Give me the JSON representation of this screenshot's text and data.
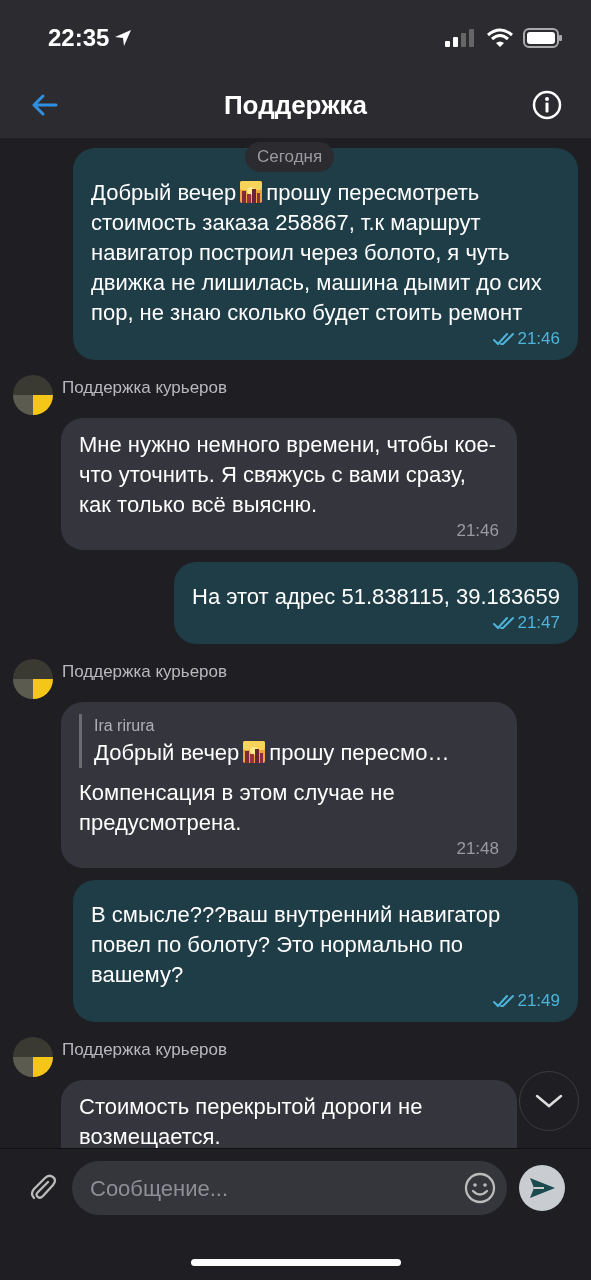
{
  "status_bar": {
    "time": "22:35"
  },
  "header": {
    "title": "Поддержка"
  },
  "date_label": "Сегодня",
  "messages": [
    {
      "kind": "outgoing",
      "segments": [
        {
          "kind": "text",
          "text": "Добрый вечер"
        },
        {
          "kind": "emoji"
        },
        {
          "kind": "text",
          "text": "прошу пересмотреть стоимость заказа 258867, т.к маршрут навигатор построил через болото, я чуть движка не лишилась, машина дымит до сих пор, не знаю сколько будет стоить ремонт"
        }
      ],
      "time": "21:46",
      "read": true
    },
    {
      "kind": "incoming",
      "sender": "Поддержка курьеров",
      "segments": [
        {
          "kind": "text",
          "text": "Мне нужно немного времени, чтобы кое-что уточнить. Я свяжусь с вами сразу, как только всё выясню."
        }
      ],
      "time": "21:46"
    },
    {
      "kind": "outgoing",
      "segments": [
        {
          "kind": "text",
          "text": "На этот адрес 51.838115, 39.183659"
        }
      ],
      "time": "21:47",
      "read": true
    },
    {
      "kind": "incoming",
      "sender": "Поддержка курьеров",
      "reply_to": {
        "author": "Ira rirura",
        "segments": [
          {
            "kind": "text",
            "text": "Добрый вечер"
          },
          {
            "kind": "emoji"
          },
          {
            "kind": "text",
            "text": "прошу пересмо…"
          }
        ]
      },
      "segments": [
        {
          "kind": "text",
          "text": "Компенсация в этом случае не предусмотрена."
        }
      ],
      "time": "21:48"
    },
    {
      "kind": "outgoing",
      "segments": [
        {
          "kind": "text",
          "text": "В смысле???ваш внутренний навигатор повел по болоту? Это нормально по вашему?"
        }
      ],
      "time": "21:49",
      "read": true
    },
    {
      "kind": "incoming",
      "sender": "Поддержка курьеров",
      "segments": [
        {
          "kind": "text",
          "text": "Стоимость перекрытой дороги не возмещается."
        }
      ]
    }
  ],
  "composer": {
    "placeholder": "Сообщение..."
  }
}
